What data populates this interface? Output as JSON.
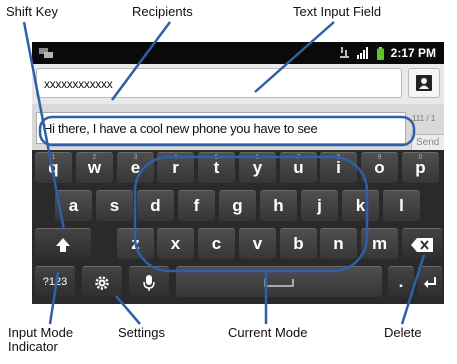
{
  "callouts": {
    "shift_key": "Shift Key",
    "recipients": "Recipients",
    "text_input_field": "Text Input Field",
    "input_mode_line1": "Input Mode",
    "input_mode_line2": "Indicator",
    "settings": "Settings",
    "current_mode": "Current Mode",
    "delete": "Delete"
  },
  "status_bar": {
    "time": "2:17 PM",
    "icons": [
      "sync-icon",
      "network-type-icon",
      "signal-icon",
      "battery-icon"
    ]
  },
  "recipient": {
    "value": "xxxxxxxxxxxx",
    "button_icon": "contact-card-icon"
  },
  "message": {
    "value": "Hi there, I have a cool new phone you have to see",
    "counter": "111 / 1",
    "send_label": "Send"
  },
  "keyboard": {
    "row1": [
      {
        "label": "q",
        "hint": "1"
      },
      {
        "label": "w",
        "hint": "2"
      },
      {
        "label": "e",
        "hint": "3"
      },
      {
        "label": "r",
        "hint": "4"
      },
      {
        "label": "t",
        "hint": "5"
      },
      {
        "label": "y",
        "hint": "6"
      },
      {
        "label": "u",
        "hint": "7"
      },
      {
        "label": "i",
        "hint": "8"
      },
      {
        "label": "o",
        "hint": "9"
      },
      {
        "label": "p",
        "hint": "0"
      }
    ],
    "row2": [
      "a",
      "s",
      "d",
      "f",
      "g",
      "h",
      "j",
      "k",
      "l"
    ],
    "row3": [
      "z",
      "x",
      "c",
      "v",
      "b",
      "n",
      "m"
    ],
    "mode_label": "?123",
    "period_label": ".",
    "icons": {
      "shift": "shift-arrow-icon",
      "delete": "backspace-icon",
      "settings": "gear-icon",
      "voice": "microphone-icon",
      "space": "space-bar-icon",
      "enter": "enter-icon"
    }
  },
  "colors": {
    "annotation_blue": "#2f5fa8",
    "keyboard_bg": "#2a2a2a",
    "key_text": "#ffffff"
  }
}
